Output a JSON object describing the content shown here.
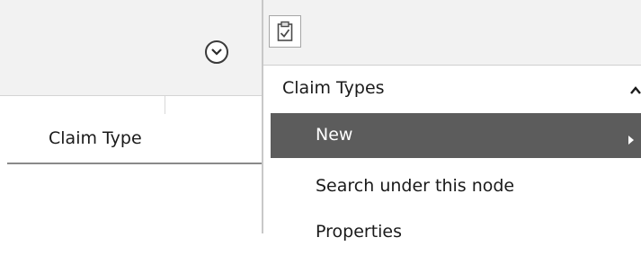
{
  "left_pane": {
    "column_header": "Claim Type",
    "collapse_icon": "chevron-down-circle-icon"
  },
  "right_pane": {
    "toolbar_icon": "clipboard-check-icon",
    "section": {
      "title": "Claim Types",
      "chevron_icon": "chevron-up-icon"
    },
    "actions": [
      {
        "label": "New",
        "selected": true,
        "has_submenu": true
      },
      {
        "label": "Search under this node",
        "selected": false,
        "has_submenu": false
      },
      {
        "label": "Properties",
        "selected": false,
        "has_submenu": false
      }
    ]
  },
  "colors": {
    "selected_bg": "#5c5c5c",
    "header_bg": "#f2f2f2"
  }
}
